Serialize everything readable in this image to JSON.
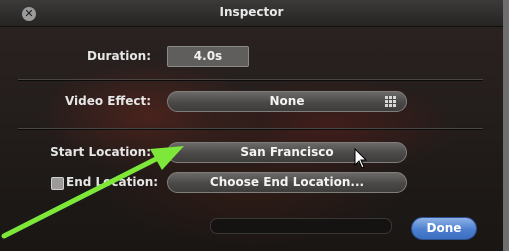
{
  "window": {
    "title": "Inspector",
    "close_glyph": "✕"
  },
  "duration": {
    "label": "Duration:",
    "value": "4.0s"
  },
  "video_effect": {
    "label": "Video Effect:",
    "value": "None",
    "icon": "grid-icon"
  },
  "start_location": {
    "label": "Start Location:",
    "value": "San Francisco"
  },
  "end_location": {
    "label": "End Location:",
    "checked": false,
    "button_label": "Choose End Location..."
  },
  "footer": {
    "done_label": "Done"
  },
  "colors": {
    "accent_arrow": "#7de83a",
    "done_button": "#4c7fcf"
  }
}
